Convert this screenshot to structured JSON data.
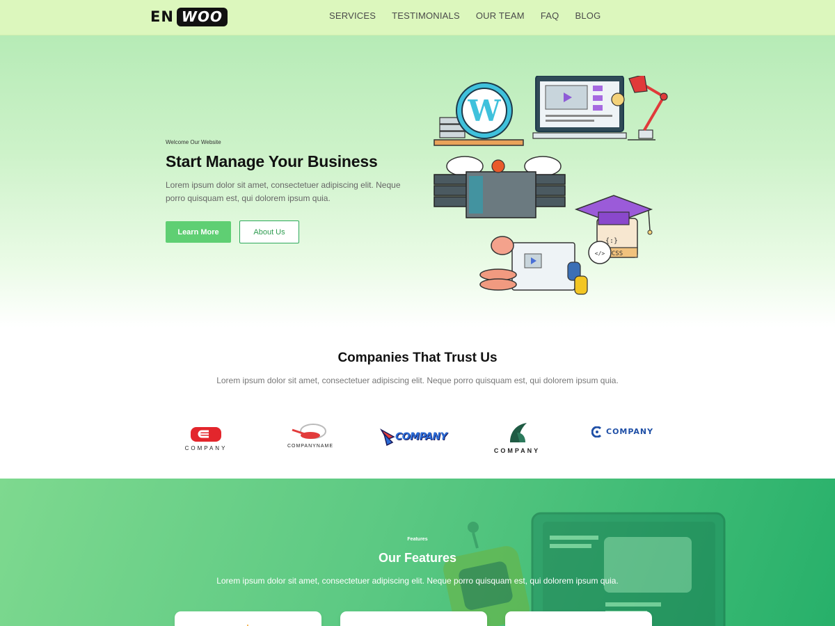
{
  "header": {
    "logo_left": "EN",
    "logo_right": "WOO",
    "nav": [
      "SERVICES",
      "TESTIMONIALS",
      "OUR TEAM",
      "FAQ",
      "BLOG"
    ]
  },
  "hero": {
    "kicker": "Welcome Our Website",
    "title": "Start Manage Your Business",
    "text": "Lorem ipsum dolor sit amet, consectetuer adipiscing elit. Neque porro quisquam est, qui dolorem ipsum quia.",
    "learn_more": "Learn More",
    "about_us": "About Us"
  },
  "companies": {
    "title": "Companies That Trust Us",
    "text": "Lorem ipsum dolor sit amet, consectetuer adipiscing elit. Neque porro quisquam est, qui dolorem ipsum quia.",
    "logos": [
      "COMPANY",
      "COMPANYNAME",
      "COMPANY",
      "COMPANY",
      "COMPANY"
    ]
  },
  "features": {
    "kicker": "Features",
    "title": "Our Features",
    "text": "Lorem ipsum dolor sit amet, consectetuer adipiscing elit. Neque porro quisquam est, qui dolorem ipsum quia."
  },
  "colors": {
    "header_bg": "#dcf7bd",
    "primary_green": "#5fcf73",
    "accent_green": "#2da85a"
  }
}
